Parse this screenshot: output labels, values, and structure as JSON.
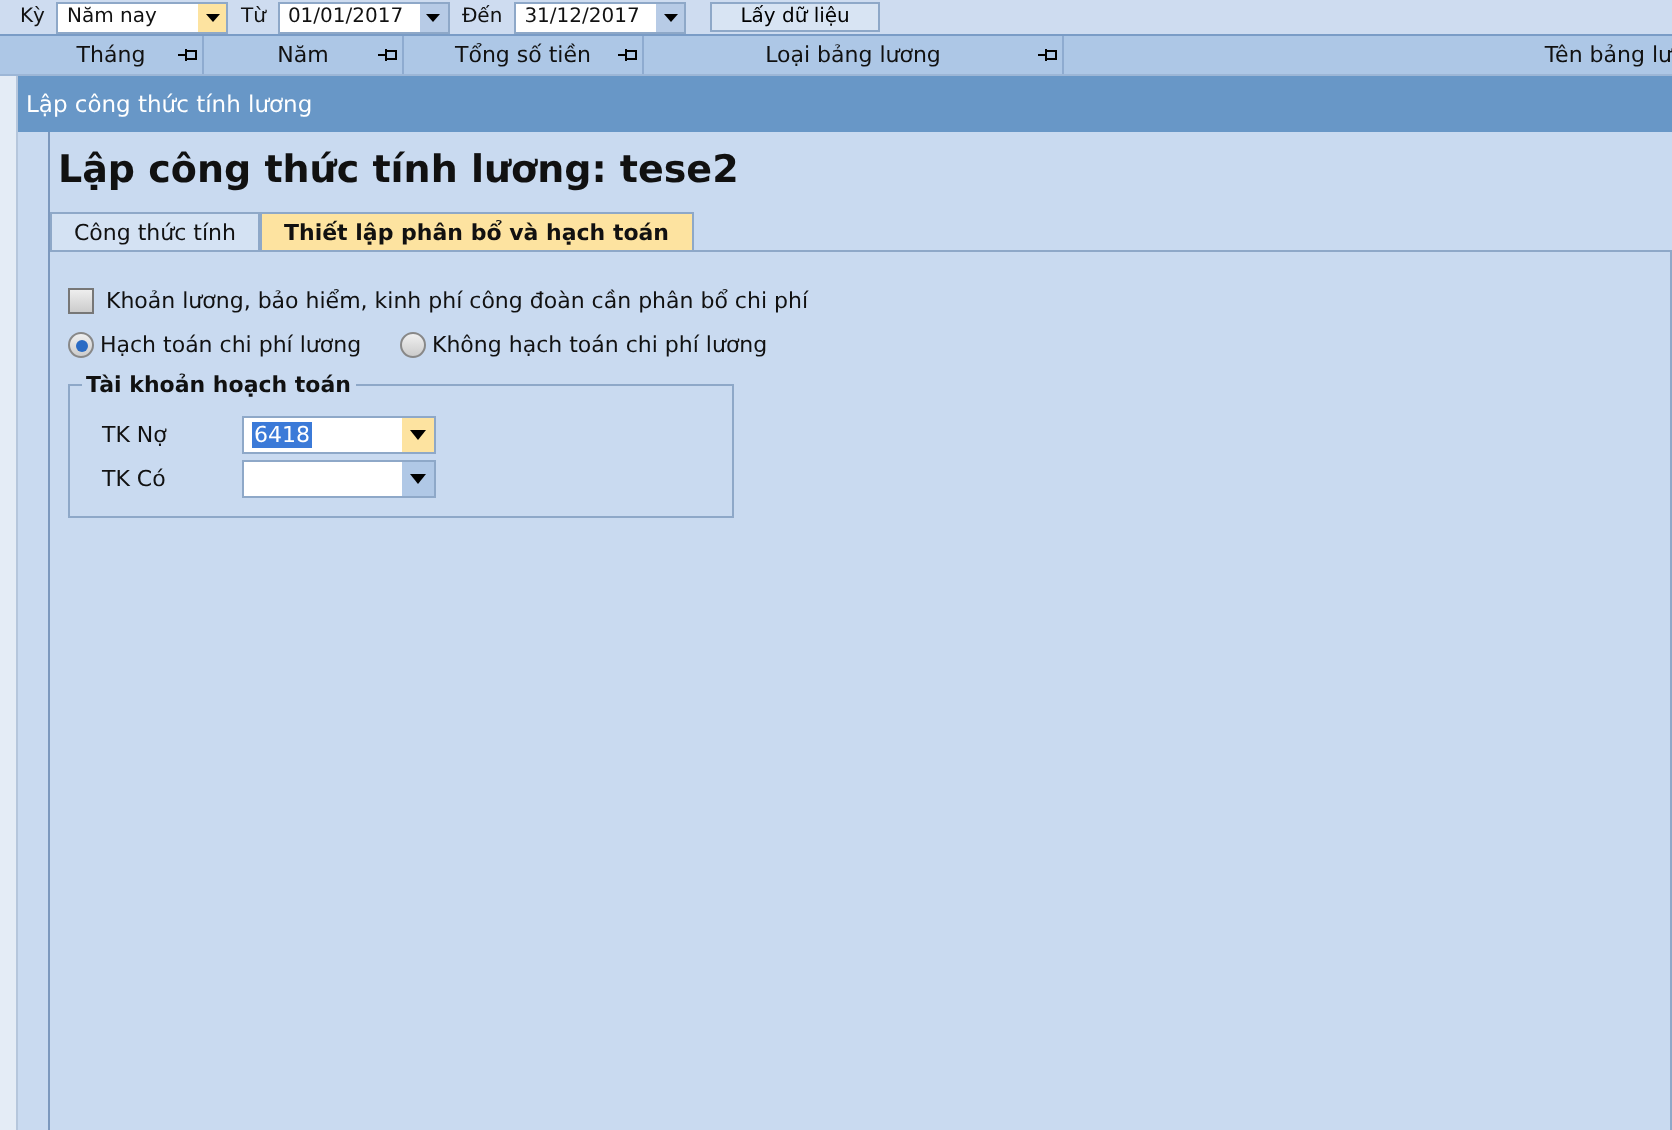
{
  "toolbar": {
    "fields": [
      {
        "label": "Kỳ",
        "value": "Năm nay",
        "highlighted": true
      },
      {
        "label": "Từ",
        "value": "01/01/2017",
        "highlighted": false
      },
      {
        "label": "Đến",
        "value": "31/12/2017",
        "highlighted": false
      }
    ],
    "button": "Lấy dữ liệu"
  },
  "grid": {
    "columns": [
      {
        "label": "Tháng",
        "pinnable": true
      },
      {
        "label": "Năm",
        "pinnable": true
      },
      {
        "label": "Tổng số tiền",
        "pinnable": true
      },
      {
        "label": "Loại bảng lương",
        "pinnable": true
      },
      {
        "label": "Tên bảng lư",
        "pinnable": false
      }
    ]
  },
  "window": {
    "title": "Lập công thức tính lương"
  },
  "heading": "Lập công thức tính lương: tese2",
  "tabs": [
    {
      "label": "Công thức tính",
      "selected": false
    },
    {
      "label": "Thiết lập phân bổ và hạch toán",
      "selected": true
    }
  ],
  "allocate_checkbox": {
    "label": "Khoản lương, bảo hiểm, kinh phí công đoàn cần phân bổ chi phí",
    "checked": false
  },
  "radios": [
    {
      "label": "Hạch toán chi phí lương",
      "selected": true
    },
    {
      "label": "Không hạch toán chi phí lương",
      "selected": false
    }
  ],
  "account_group": {
    "title": "Tài khoản hoạch toán",
    "fields": [
      {
        "label": "TK Nợ",
        "value": "6418",
        "focused": true
      },
      {
        "label": "TK Có",
        "focused": false
      }
    ]
  }
}
